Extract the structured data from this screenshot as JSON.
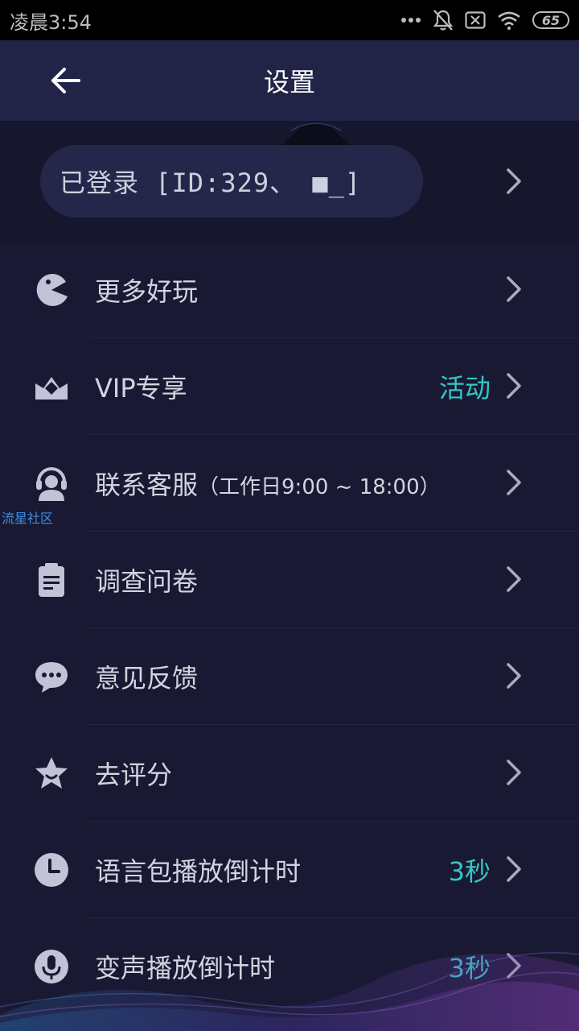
{
  "status_bar": {
    "time": "凌晨3:54",
    "battery": "65",
    "icons": [
      "more-dots-icon",
      "bell-muted-icon",
      "sim-off-icon",
      "wifi-icon",
      "battery-icon"
    ]
  },
  "app_bar": {
    "title": "设置",
    "back_icon": "arrow-left-icon"
  },
  "login": {
    "text": "已登录 [ID:329、 ■_]"
  },
  "menu": [
    {
      "label": "更多好玩",
      "sub": "",
      "value": "",
      "icon": "pacman-icon"
    },
    {
      "label": "VIP专享",
      "sub": "",
      "value": "活动",
      "icon": "crown-icon"
    },
    {
      "label": "联系客服",
      "sub": "（工作日9:00 ~ 18:00）",
      "value": "",
      "icon": "headset-user-icon"
    },
    {
      "label": "调查问卷",
      "sub": "",
      "value": "",
      "icon": "clipboard-icon"
    },
    {
      "label": "意见反馈",
      "sub": "",
      "value": "",
      "icon": "chat-bubble-icon"
    },
    {
      "label": "去评分",
      "sub": "",
      "value": "",
      "icon": "star-icon"
    },
    {
      "label": "语言包播放倒计时",
      "sub": "",
      "value": "3秒",
      "icon": "clock-icon"
    },
    {
      "label": "变声播放倒计时",
      "sub": "",
      "value": "3秒",
      "icon": "microphone-icon"
    }
  ],
  "overlay": {
    "community_label": "流星社区"
  },
  "colors": {
    "background": "#191933",
    "app_bar": "#222447",
    "accent": "#35c7c4",
    "text": "#d2d4e0",
    "icon": "#c0c4d6"
  }
}
